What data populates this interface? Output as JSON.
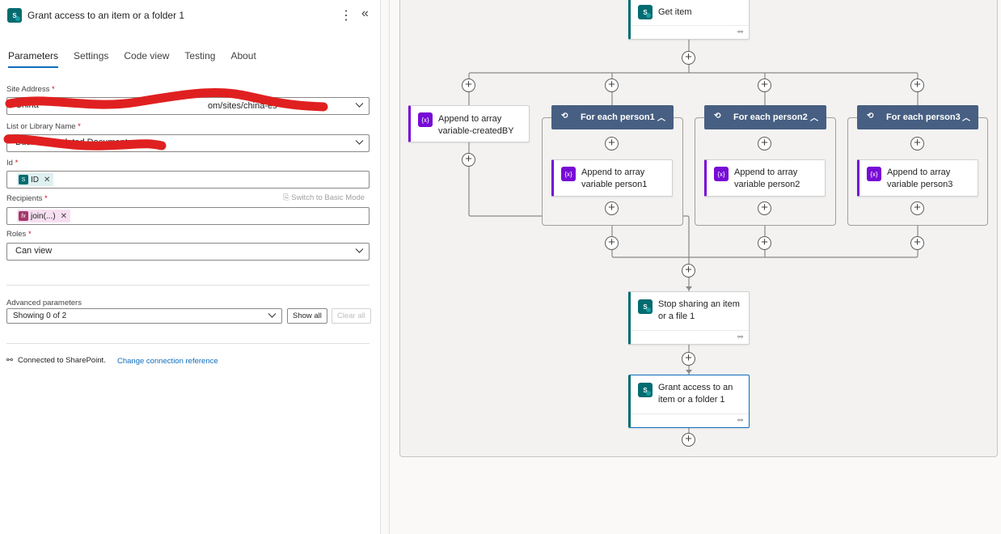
{
  "panel": {
    "title": "Grant access to an item or a folder 1",
    "tabs": [
      "Parameters",
      "Settings",
      "Code view",
      "Testing",
      "About"
    ],
    "fields": {
      "site_address": {
        "label": "Site Address",
        "value": "China",
        "value_tail": "om/sites/china-es"
      },
      "list_name": {
        "label": "List or Library Name",
        "value": "Business Related Documents"
      },
      "id": {
        "label": "Id",
        "token": "ID"
      },
      "recipients": {
        "label": "Recipients",
        "token": "join(...)",
        "switch_mode": "Switch to Basic Mode"
      },
      "roles": {
        "label": "Roles",
        "value": "Can view"
      }
    },
    "required_mark": "*",
    "advanced": {
      "label": "Advanced parameters",
      "value": "Showing 0 of 2",
      "show_all": "Show all",
      "clear_all": "Clear all"
    },
    "connection": {
      "status": "Connected to SharePoint.",
      "change": "Change connection reference"
    }
  },
  "flow": {
    "get_item": "Get item",
    "append_created_by": "Append to array variable-createdBY",
    "loops": [
      {
        "title": "For each person1",
        "inner": "Append to array variable person1"
      },
      {
        "title": "For each person2",
        "inner": "Append to array variable person2"
      },
      {
        "title": "For each person3",
        "inner": "Append to array variable person3"
      }
    ],
    "stop_sharing": "Stop sharing an item or a file 1",
    "grant_access": "Grant access to an item or a folder 1"
  },
  "colors": {
    "sharepoint": "#036c70",
    "variable": "#770bd6",
    "loop_header": "#475f82",
    "accent": "#0f6cbd",
    "redaction": "#e02020"
  }
}
